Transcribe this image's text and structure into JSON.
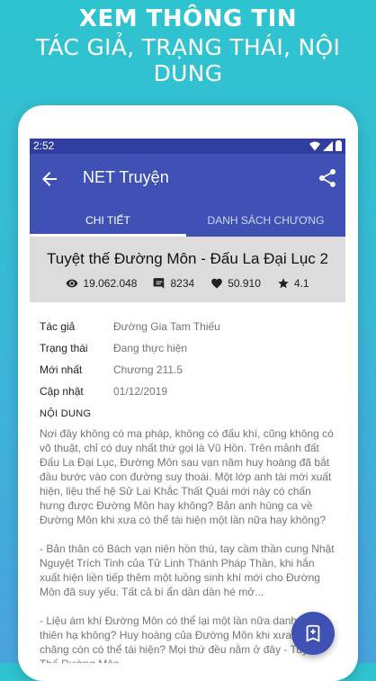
{
  "promo": {
    "title": "XEM THÔNG TIN",
    "subtitle": "TÁC GIẢ, TRẠNG THÁI, NỘI DUNG"
  },
  "status_bar": {
    "time": "2:52"
  },
  "app_bar": {
    "title": "NET Truyện",
    "back_icon": "arrow-back-icon",
    "share_icon": "share-icon"
  },
  "tabs": [
    {
      "label": "CHI TIẾT",
      "active": true
    },
    {
      "label": "DANH SÁCH CHƯƠNG",
      "active": false
    }
  ],
  "story": {
    "title": "Tuyệt thế Đường Môn - Đấu La Đại Lục 2",
    "views": "19.062.048",
    "comments": "8234",
    "likes": "50.910",
    "rating": "4.1"
  },
  "info": [
    {
      "label": "Tác giả",
      "value": "Đường Gia Tam Thiếu"
    },
    {
      "label": "Trạng thái",
      "value": "Đang thực hiện"
    },
    {
      "label": "Mới nhất",
      "value": "Chương 211.5"
    },
    {
      "label": "Cập nhật",
      "value": "01/12/2019"
    }
  ],
  "synopsis": {
    "heading": "NỘI DUNG",
    "paragraphs": [
      "Nơi đây không có ma pháp, không có đấu khí, cũng không có võ thuật, chỉ có duy nhất thứ gọi là Vũ Hồn. Trên mảnh đất Đấu La Đại Lục, Đường Môn sau vạn năm huy hoàng đã bắt đầu bước vào con đường suy thoái. Một lớp anh tài mới xuất hiện, liệu thế hệ Sử Lai Khắc Thất Quái mới này có chấn hưng được Đường Môn hay không? Bản anh hùng ca về Đường Môn khi xưa có thể tái hiện một lần nữa hay không?",
      "- Bản thân có Bách vạn niên hồn thú, tay cầm thần cung Nhật Nguyệt Trích Tinh của Tử Linh Thánh Pháp Thần, khi hắn xuất hiện liền tiếp thêm một luồng sinh khí mới cho Đường Môn đã suy yếu. Tất cả bí ẩn dần dần hé mở...",
      "- Liệu ám khí Đường Môn có thể lại một lần nữa danh chấn thiên hạ không? Huy hoàng của Đường Môn khi xưa phải chăng còn có thể tái hiện? Mọi thứ đều nằm ở đây - Tuyệt Thế Đường Môn."
    ]
  },
  "fab": {
    "icon": "bookmark-add-icon"
  },
  "colors": {
    "primary": "#3f51b5",
    "primary_dark": "#303f9f",
    "background_top": "#2ec4cf",
    "background_bottom": "#4aa3df"
  }
}
